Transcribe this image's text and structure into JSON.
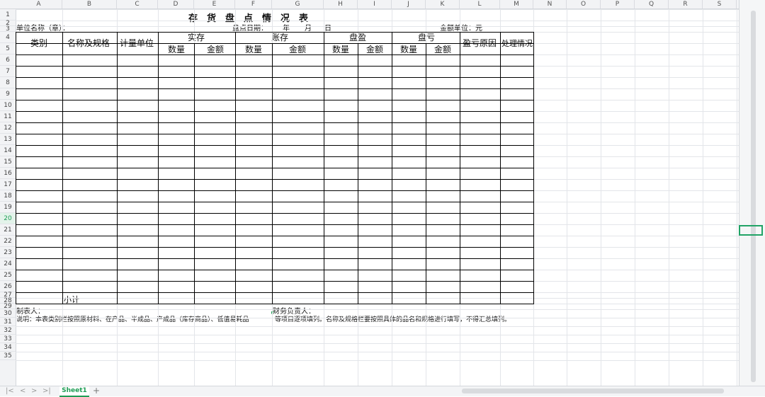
{
  "columns": [
    "A",
    "B",
    "C",
    "D",
    "E",
    "F",
    "G",
    "H",
    "I",
    "J",
    "K",
    "L",
    "M",
    "N",
    "O",
    "P",
    "Q",
    "R",
    "S"
  ],
  "rows": [
    "1",
    "2",
    "3",
    "4",
    "5",
    "6",
    "7",
    "8",
    "9",
    "10",
    "11",
    "12",
    "13",
    "14",
    "15",
    "16",
    "17",
    "18",
    "19",
    "20",
    "21",
    "22",
    "23",
    "24",
    "25",
    "26",
    "27",
    "28",
    "29",
    "30",
    "31",
    "32",
    "33",
    "34",
    "35"
  ],
  "selected_row": "20",
  "sheet": {
    "title": "存货盘点情况表",
    "unit_name": "单位名称（章）：",
    "check_date": "盘点日期：",
    "year": "年",
    "month": "月",
    "day": "日",
    "amount_unit": "金额单位：元",
    "headers": {
      "category": "类别",
      "name_spec": "名称及规格",
      "unit": "计量单位",
      "actual": "实存",
      "book": "账存",
      "surplus": "盘盈",
      "loss": "盘亏",
      "qty_actual": "数量",
      "amt_actual": "金额",
      "qty_book": "数量",
      "amt_book": "金额",
      "qty_surplus": "数量",
      "amt_surplus": "金额",
      "qty_loss": "数量",
      "amt_loss": "金额",
      "reason": "盈亏原因",
      "handling": "处理情况"
    },
    "subtotal": "小计",
    "preparer": "制表人：",
    "finance_head": "财务负责人：",
    "note_a": "说明：本表类别栏按照原材料、在产品、半成品、产成品（库存商品）、低值易耗品",
    "note_b": "等项目逐项填列。名称及规格栏要按照具体的品名和规格进行填写，不得汇总填列。"
  },
  "tabs": {
    "active": "Sheet1",
    "add": "+"
  },
  "nav": {
    "first": "|<",
    "prev": "<",
    "next": ">",
    "last": ">|"
  }
}
